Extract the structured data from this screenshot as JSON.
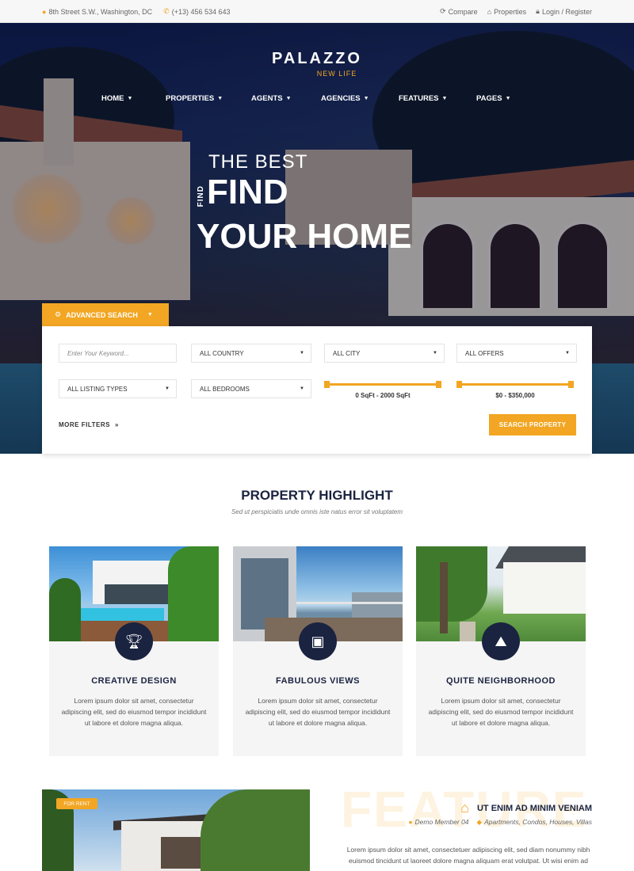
{
  "topbar": {
    "address": "8th Street S.W., Washington, DC",
    "phone": "(+13) 456 534 643",
    "compare": "Compare",
    "properties": "Properties",
    "login": "Login / Register"
  },
  "logo": {
    "name": "PALAZZO",
    "tagline": "NEW LIFE"
  },
  "nav": [
    "HOME",
    "PROPERTIES",
    "AGENTS",
    "AGENCIES",
    "FEATURES",
    "PAGES"
  ],
  "hero": {
    "line1": "THE BEST",
    "vertical": "FIND",
    "line2": "FIND",
    "line3": "YOUR HOME"
  },
  "search": {
    "tab_label": "ADVANCED SEARCH",
    "keyword_placeholder": "Enter Your Keyword...",
    "country": "ALL COUNTRY",
    "city": "ALL CITY",
    "offers": "ALL OFFERS",
    "listing_types": "ALL LISTING TYPES",
    "bedrooms": "ALL BEDROOMS",
    "area_range": "0 SqFt - 2000 SqFt",
    "price_range": "$0 - $350,000",
    "more_filters": "MORE FILTERS",
    "search_button": "SEARCH PROPERTY"
  },
  "highlight": {
    "title": "PROPERTY HIGHLIGHT",
    "subtitle": "Sed ut perspiciatis unde omnis iste natus error sit voluptatem",
    "cards": [
      {
        "title": "CREATIVE DESIGN",
        "text": "Lorem ipsum dolor sit amet, consectetur adipiscing elit, sed do eiusmod tempor incididunt ut labore et dolore magna aliqua.",
        "icon": "trophy-icon"
      },
      {
        "title": "FABULOUS VIEWS",
        "text": "Lorem ipsum dolor sit amet, consectetur adipiscing elit, sed do eiusmod tempor incididunt ut labore et dolore magna aliqua.",
        "icon": "image-icon"
      },
      {
        "title": "QUITE NEIGHBORHOOD",
        "text": "Lorem ipsum dolor sit amet, consectetur adipiscing elit, sed do eiusmod tempor incididunt ut labore et dolore magna aliqua.",
        "icon": "map-icon"
      }
    ]
  },
  "featured": {
    "badge": "FOR RENT",
    "watermark": "FEATURE",
    "title": "UT ENIM AD MINIM VENIAM",
    "member": "Demo Member 04",
    "categories": "Apartments, Condos, Houses, Villas",
    "text": "Lorem ipsum dolor sit amet, consectetuer adipiscing elit, sed diam nonummy nibh euismod tincidunt ut laoreet dolore magna aliquam erat volutpat. Ut wisi enim ad"
  },
  "colors": {
    "accent": "#f2a623",
    "navy": "#1a2340"
  }
}
